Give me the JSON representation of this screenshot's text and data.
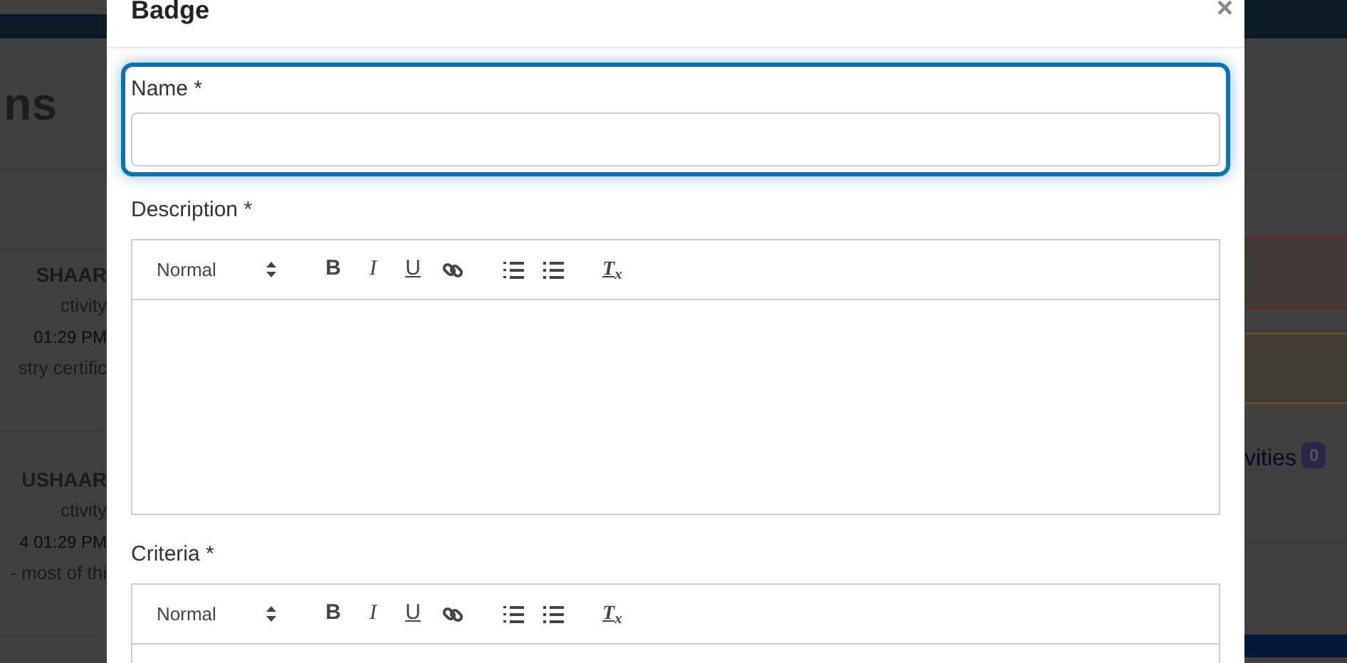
{
  "background_page": {
    "title_fragment": "ns",
    "cards": [
      {
        "name": "SHAAR",
        "type": "ctivity",
        "time": "01:29 PM",
        "text": "stry certific"
      },
      {
        "name": "USHAAR",
        "type": "ctivity",
        "time": "4 01:29 PM",
        "text": "- most of thi"
      }
    ],
    "activities_label": "vities",
    "activities_count": "0"
  },
  "dialog": {
    "title": "Badge",
    "close": "×",
    "fields": [
      {
        "kind": "text",
        "label": "Name *",
        "focused": true
      },
      {
        "kind": "editor",
        "label": "Description *",
        "format": "Normal",
        "toolbar": [
          {
            "kind": "bold",
            "label": "B"
          },
          {
            "kind": "italic",
            "label": "I"
          },
          {
            "kind": "underline",
            "label": "U"
          },
          {
            "kind": "link"
          },
          {
            "kind": "ordered_list"
          },
          {
            "kind": "bullet_list"
          },
          {
            "kind": "clean",
            "label": "T$_{x}$"
          }
        ]
      },
      {
        "kind": "editor",
        "label": "Criteria *",
        "format": "Normal",
        "toolbar": [
          {
            "kind": "bold",
            "label": "B"
          },
          {
            "kind": "italic",
            "label": "I"
          },
          {
            "kind": "underline",
            "label": "U"
          },
          {
            "kind": "link"
          },
          {
            "kind": "ordered_list"
          },
          {
            "kind": "bullet_list"
          },
          {
            "kind": "clean",
            "label": "T$_{x}$"
          }
        ]
      }
    ]
  }
}
